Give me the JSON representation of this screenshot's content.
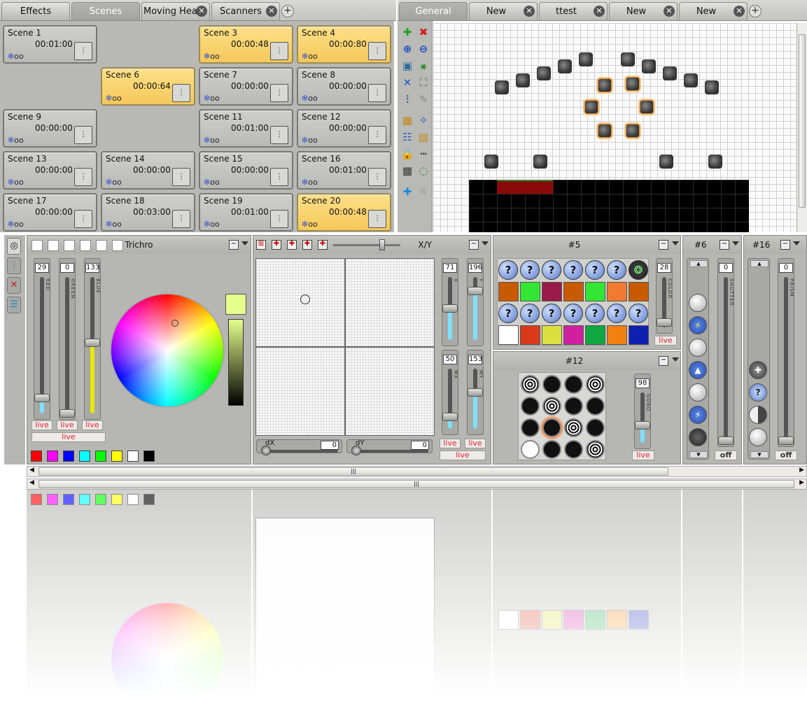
{
  "left_tabs": [
    {
      "label": "Effects",
      "closable": false,
      "active": false
    },
    {
      "label": "Scenes",
      "closable": false,
      "active": true
    },
    {
      "label": "Moving Head",
      "closable": true,
      "active": false
    },
    {
      "label": "Scanners",
      "closable": true,
      "active": false
    }
  ],
  "right_tabs": [
    {
      "label": "General",
      "closable": false,
      "active": true
    },
    {
      "label": "New",
      "closable": true,
      "active": false
    },
    {
      "label": "ttest",
      "closable": true,
      "active": false
    },
    {
      "label": "New",
      "closable": true,
      "active": false
    },
    {
      "label": "New",
      "closable": true,
      "active": false
    }
  ],
  "scene_footer_text": "oo",
  "scenes": [
    {
      "name": "Scene 1",
      "time": "00:01:00",
      "active": false
    },
    {
      "name": "Scene 3",
      "time": "00:00:48",
      "active": true
    },
    {
      "name": "Scene 4",
      "time": "00:00:80",
      "active": true
    },
    {
      "name": "Scene 6",
      "time": "00:00:64",
      "active": true
    },
    {
      "name": "Scene 7",
      "time": "00:00:00",
      "active": false
    },
    {
      "name": "Scene 8",
      "time": "00:00:00",
      "active": false
    },
    {
      "name": "Scene 9",
      "time": "00:00:00",
      "active": false
    },
    {
      "name": "Scene 11",
      "time": "00:01:00",
      "active": false
    },
    {
      "name": "Scene 12",
      "time": "00:00:00",
      "active": false
    },
    {
      "name": "Scene 13",
      "time": "00:00:00",
      "active": false
    },
    {
      "name": "Scene 14",
      "time": "00:00:00",
      "active": false
    },
    {
      "name": "Scene 15",
      "time": "00:00:00",
      "active": false
    },
    {
      "name": "Scene 16",
      "time": "00:01:00",
      "active": false
    },
    {
      "name": "Scene 17",
      "time": "00:00:00",
      "active": false
    },
    {
      "name": "Scene 18",
      "time": "00:03:00",
      "active": false
    },
    {
      "name": "Scene 19",
      "time": "00:01:00",
      "active": false
    },
    {
      "name": "Scene 20",
      "time": "00:00:48",
      "active": true
    }
  ],
  "trichro": {
    "title": "Trichro",
    "faders": [
      {
        "label": "RED",
        "value": "29",
        "level": 0.114,
        "fill": "#7fe0ff"
      },
      {
        "label": "GREEN",
        "value": "0",
        "level": 0.0,
        "fill": "#7fe0ff"
      },
      {
        "label": "BLUE",
        "value": "133",
        "level": 0.52,
        "fill": "#e8e800"
      }
    ],
    "live_label": "live",
    "preview_color": "#e6ff8c",
    "presets": [
      "#ff0000",
      "#ff00ff",
      "#0000ff",
      "#00ffff",
      "#00ff00",
      "#ffff00",
      "#ffffff",
      "#000000"
    ]
  },
  "xy": {
    "title": "X/Y",
    "x": {
      "label": "X",
      "value": "71"
    },
    "y": {
      "label": "Y",
      "value": "196"
    },
    "mx": {
      "label": "MX",
      "value": "50"
    },
    "my": {
      "label": "MY",
      "value": "153"
    },
    "dx": {
      "label": "dX",
      "value": "0"
    },
    "dy": {
      "label": "dY",
      "value": "0"
    },
    "live_label": "live"
  },
  "color_panel": {
    "title": "#5",
    "fader": {
      "label": "COLOR",
      "value": "28"
    },
    "live_label": "live",
    "swatch_rows": [
      [
        "#c85a00",
        "#33e633",
        "#9a1a4a",
        "#c85a00",
        "#33e633",
        "#f07a30",
        "#c85a00"
      ],
      [
        "#ffffff",
        "#d83a1a",
        "#dbe040",
        "#d020a0",
        "#10a840",
        "#f08010",
        "#1020b0"
      ]
    ],
    "unknown_symbol": "?"
  },
  "gobo_panel": {
    "title": "#12",
    "fader": {
      "label": "GOBO",
      "value": "98"
    },
    "live_label": "live"
  },
  "shutter_panel": {
    "title": "#6",
    "fader": {
      "label": "SHUTTER",
      "value": "0"
    },
    "off_label": "off"
  },
  "prism_panel": {
    "title": "#16",
    "fader": {
      "label": "PRISM",
      "value": "0"
    },
    "off_label": "off",
    "unknown_symbol": "?"
  },
  "scrollbar_grip": "|||"
}
